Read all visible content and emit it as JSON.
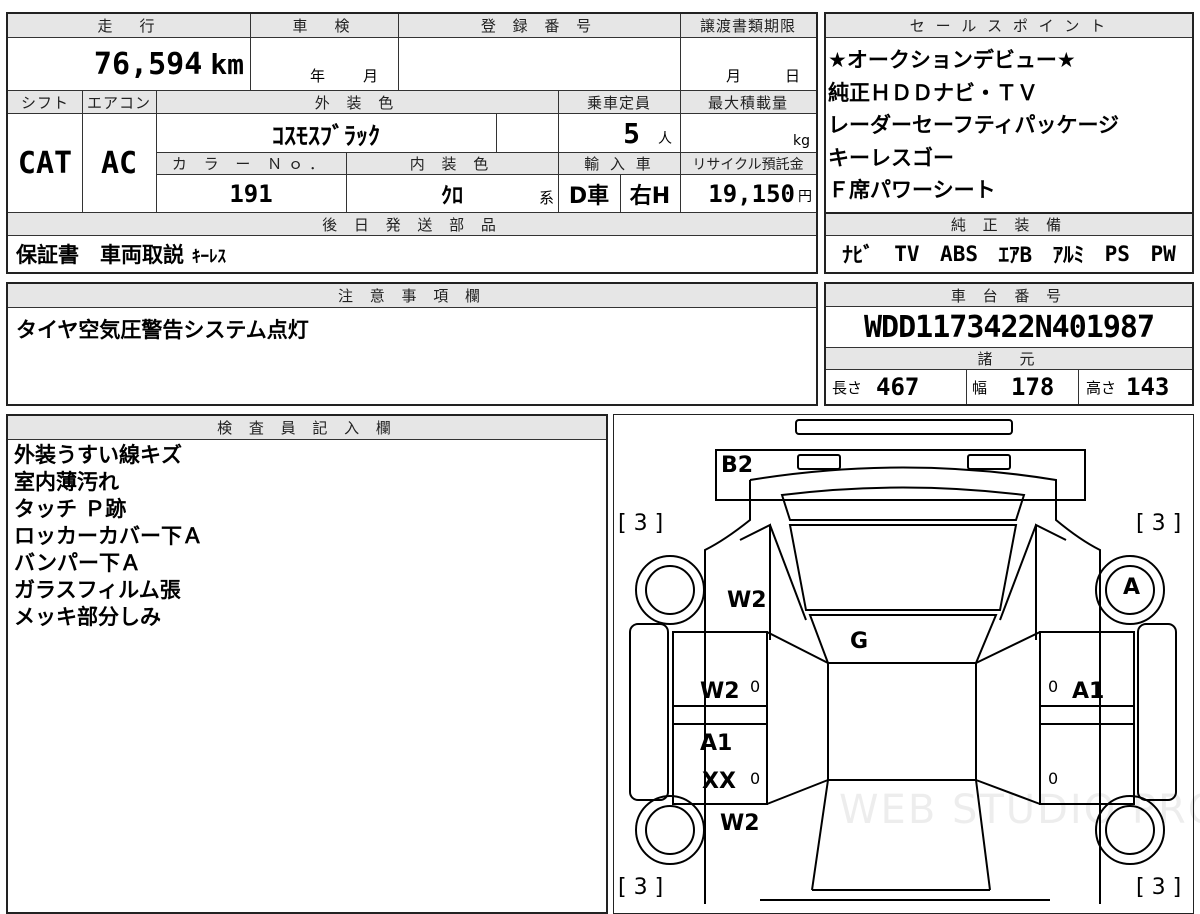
{
  "main": {
    "mileage_header": "走　行",
    "mileage": "76,594",
    "mileage_unit": "km",
    "shaken_header": "車　検",
    "shaken_year": "年",
    "shaken_month": "月",
    "reg_header": "登 録 番 号",
    "transfer_header": "譲渡書類期限",
    "transfer_month": "月",
    "transfer_day": "日",
    "shift_header": "シフト",
    "shift": "CAT",
    "ac_header": "エアコン",
    "ac": "AC",
    "exterior_header": "外 装 色",
    "exterior": "ｺｽﾓｽﾌﾞﾗｯｸ",
    "capacity_header": "乗車定員",
    "capacity": "5",
    "capacity_unit": "人",
    "maxload_header": "最大積載量",
    "maxload_unit": "kg",
    "colorno_header": "カ ラ ー Ｎｏ．",
    "colorno": "191",
    "interior_header": "内 装 色",
    "interior": "ｸﾛ",
    "interior_suffix": "系",
    "import_header": "輸 入 車",
    "import_type": "D車",
    "handle": "右H",
    "recycle_header": "リサイクル預託金",
    "recycle": "19,150",
    "recycle_unit": "円",
    "later_header": "後 日 発 送 部 品",
    "later_parts": "保証書　車両取説",
    "later_parts_small": "ｷｰﾚｽ"
  },
  "sales": {
    "header": "セ ー ル ス ポ イ ン ト",
    "items": [
      "★オークションデビュー★",
      "純正ＨＤＤナビ・ＴＶ",
      "レーダーセーフティパッケージ",
      "キーレスゴー",
      "Ｆ席パワーシート"
    ]
  },
  "equipment": {
    "header": "純 正 装 備",
    "items": [
      "ﾅﾋﾞ",
      "TV",
      "ABS",
      "ｴｱB",
      "ｱﾙﾐ",
      "PS",
      "PW"
    ]
  },
  "notes": {
    "header": "注 意 事 項 欄",
    "text": "タイヤ空気圧警告システム点灯"
  },
  "chassis": {
    "header": "車 台 番 号",
    "number": "WDD1173422N401987",
    "spec_header": "諸　元",
    "length_label": "長さ",
    "length": "467",
    "width_label": "幅",
    "width": "178",
    "height_label": "高さ",
    "height": "143"
  },
  "inspector": {
    "header": "検 査 員 記 入 欄",
    "items": [
      "外装うすい線キズ",
      "室内薄汚れ",
      "タッチ Ｐ跡",
      "ロッカーカバー下Ａ",
      "バンパー下Ａ",
      "ガラスフィルム張",
      "メッキ部分しみ"
    ]
  },
  "diagram": {
    "marks": {
      "rear_bumper": "B2",
      "tire_fl": "[ 3 ]",
      "tire_fr": "[ 3 ]",
      "tire_rl": "[ 3 ]",
      "tire_rr": "[ 3 ]",
      "left_front": "W2",
      "right_front": "A",
      "windshield": "G",
      "left_door_front": "W2",
      "right_door_front": "A1",
      "left_rocker": "A1",
      "left_rocker2": "XX",
      "left_rear": "W2",
      "zero1": "0",
      "zero2": "0",
      "zero3": "0",
      "zero4": "0"
    },
    "watermark": "WEB STUDIO PRO"
  }
}
